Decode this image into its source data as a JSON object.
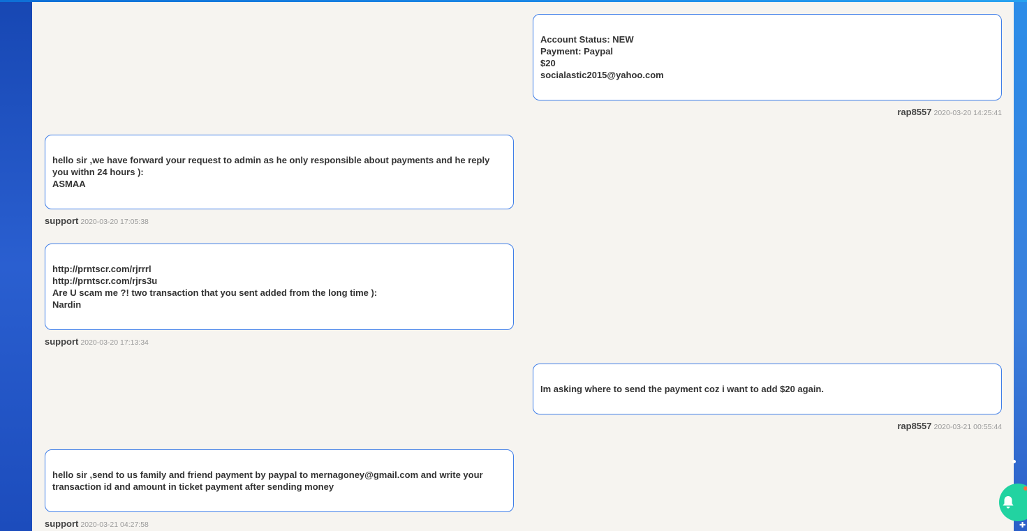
{
  "messages": [
    {
      "side": "right",
      "lines": [
        "Account Status: NEW",
        "Payment: Paypal",
        "$20",
        "socialastic2015@yahoo.com"
      ],
      "user": "rap8557",
      "timestamp": "2020-03-20 14:25:41"
    },
    {
      "side": "left",
      "lines": [
        "hello sir ,we have forward your request to admin as he only responsible about payments and he reply",
        "you withn 24 hours ):",
        "ASMAA"
      ],
      "user": "support",
      "timestamp": "2020-03-20 17:05:38"
    },
    {
      "side": "left",
      "lines": [
        "http://prntscr.com/rjrrrl",
        "http://prntscr.com/rjrs3u",
        "Are U scam me ?! two transaction that you sent added from the long time ):",
        "Nardin"
      ],
      "user": "support",
      "timestamp": "2020-03-20 17:13:34"
    },
    {
      "side": "right",
      "lines": [
        "Im asking where to send the payment coz i want to add $20 again."
      ],
      "user": "rap8557",
      "timestamp": "2020-03-21 00:55:44"
    },
    {
      "side": "left",
      "lines": [
        "hello sir ,send to us family and friend payment by paypal to mernagoney@gmail.com and write your",
        "transaction id and amount in ticket payment after sending money"
      ],
      "user": "support",
      "timestamp": "2020-03-21 04:27:58"
    }
  ],
  "icons": {
    "notification": "bell-icon"
  },
  "colors": {
    "bubble_border": "#3f7ee8",
    "chat_background": "#f6f4f0",
    "notify_button": "#22d3a1",
    "frame_blue": "#1e4fbf"
  }
}
